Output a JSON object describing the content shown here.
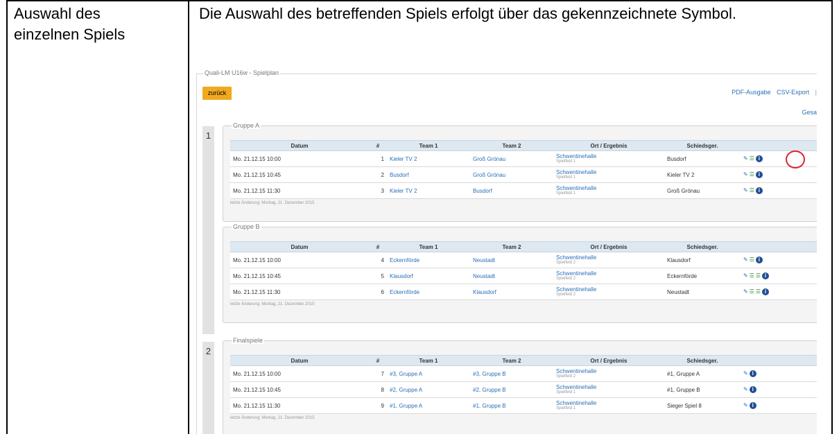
{
  "label": [
    "Auswahl des",
    "einzelnen Spiels"
  ],
  "description": "Die Auswahl des betreffenden Spiels erfolgt über das gekennzeichnete Symbol.",
  "screenshot": {
    "fieldset_title": "Quali-LM U16w - Spielplan",
    "back_button": "zurück",
    "top_links": [
      "PDF-Ausgabe",
      "CSV-Export",
      "|"
    ],
    "partial_link": "Gesa",
    "columns": [
      "Datum",
      "#",
      "Team 1",
      "Team 2",
      "Ort / Ergebnis",
      "Schiedsger."
    ],
    "rounds": [
      {
        "number": "1",
        "groups": [
          {
            "title": "Gruppe A",
            "footnote": "letzte Änderung: Montag, 21. Dezember 2015",
            "games": [
              {
                "date": "Mo. 21.12.15 10:00",
                "no": "1",
                "team1": "Kieler TV 2",
                "team2": "Groß Grönau",
                "venue": "Schwentinehalle",
                "field": "Spielfeld 1",
                "referee": "Busdorf",
                "icons": [
                  "edit-icon",
                  "list-icon",
                  "info-icon"
                ]
              },
              {
                "date": "Mo. 21.12.15 10:45",
                "no": "2",
                "team1": "Busdorf",
                "team2": "Groß Grönau",
                "venue": "Schwentinehalle",
                "field": "Spielfeld 1",
                "referee": "Kieler TV 2",
                "icons": [
                  "edit-icon",
                  "list-icon",
                  "info-icon"
                ]
              },
              {
                "date": "Mo. 21.12.15 11:30",
                "no": "3",
                "team1": "Kieler TV 2",
                "team2": "Busdorf",
                "venue": "Schwentinehalle",
                "field": "Spielfeld 1",
                "referee": "Groß Grönau",
                "icons": [
                  "edit-icon",
                  "list-icon",
                  "info-icon"
                ]
              }
            ]
          },
          {
            "title": "Gruppe B",
            "footnote": "letzte Änderung: Montag, 21. Dezember 2015",
            "games": [
              {
                "date": "Mo. 21.12.15 10:00",
                "no": "4",
                "team1": "Eckernförde",
                "team2": "Neustadt",
                "venue": "Schwentinehalle",
                "field": "Spielfeld 2",
                "referee": "Klausdorf",
                "icons": [
                  "edit-icon",
                  "list-icon",
                  "info-icon"
                ]
              },
              {
                "date": "Mo. 21.12.15 10:45",
                "no": "5",
                "team1": "Klausdorf",
                "team2": "Neustadt",
                "venue": "Schwentinehalle",
                "field": "Spielfeld 2",
                "referee": "Eckernförde",
                "icons": [
                  "edit-icon",
                  "list-icon",
                  "list-icon",
                  "info-icon"
                ]
              },
              {
                "date": "Mo. 21.12.15 11:30",
                "no": "6",
                "team1": "Eckernförde",
                "team2": "Klausdorf",
                "venue": "Schwentinehalle",
                "field": "Spielfeld 2",
                "referee": "Neustadt",
                "icons": [
                  "edit-icon",
                  "list-icon",
                  "list-icon",
                  "info-icon"
                ]
              }
            ]
          }
        ]
      },
      {
        "number": "2",
        "groups": [
          {
            "title": "Finalspiele",
            "footnote": "letzte Änderung: Montag, 21. Dezember 2015",
            "games": [
              {
                "date": "Mo. 21.12.15 10:00",
                "no": "7",
                "team1": "#3, Gruppe A",
                "team2": "#3, Gruppe B",
                "venue": "Schwentinehalle",
                "field": "Spielfeld 2",
                "referee": "#1, Gruppe A",
                "icons": [
                  "edit-icon",
                  "info-icon"
                ]
              },
              {
                "date": "Mo. 21.12.15 10:45",
                "no": "8",
                "team1": "#2, Gruppe A",
                "team2": "#2, Gruppe B",
                "venue": "Schwentinehalle",
                "field": "Spielfeld 1",
                "referee": "#1, Gruppe B",
                "icons": [
                  "edit-icon",
                  "info-icon"
                ]
              },
              {
                "date": "Mo. 21.12.15 11:30",
                "no": "9",
                "team1": "#1, Gruppe A",
                "team2": "#1, Gruppe B",
                "venue": "Schwentinehalle",
                "field": "Spielfeld 1",
                "referee": "Sieger Spiel 8",
                "icons": [
                  "edit-icon",
                  "info-icon"
                ]
              }
            ]
          }
        ]
      }
    ]
  }
}
